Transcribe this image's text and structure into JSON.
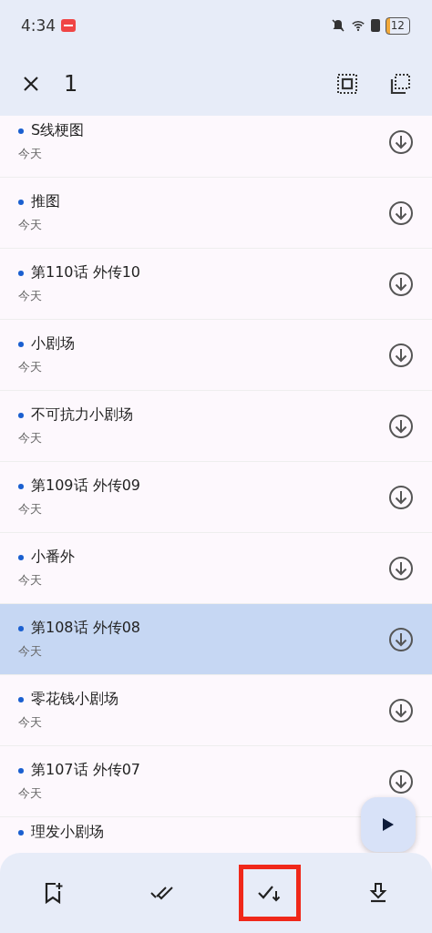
{
  "status_bar": {
    "time": "4:34",
    "battery": "12"
  },
  "top_bar": {
    "selected_count": "1"
  },
  "chapters": [
    {
      "title": "S线梗图",
      "date": "今天",
      "selected": false
    },
    {
      "title": "推图",
      "date": "今天",
      "selected": false
    },
    {
      "title": "第110话 外传10",
      "date": "今天",
      "selected": false
    },
    {
      "title": "小剧场",
      "date": "今天",
      "selected": false
    },
    {
      "title": "不可抗力小剧场",
      "date": "今天",
      "selected": false
    },
    {
      "title": "第109话 外传09",
      "date": "今天",
      "selected": false
    },
    {
      "title": "小番外",
      "date": "今天",
      "selected": false
    },
    {
      "title": "第108话 外传08",
      "date": "今天",
      "selected": true
    },
    {
      "title": "零花钱小剧场",
      "date": "今天",
      "selected": false
    },
    {
      "title": "第107话 外传07",
      "date": "今天",
      "selected": false
    },
    {
      "title": "理发小剧场",
      "selected": false
    }
  ],
  "bottom_actions": [
    {
      "kind": "bookmark",
      "highlighted": false
    },
    {
      "kind": "mark-read",
      "highlighted": false
    },
    {
      "kind": "mark-read-below",
      "highlighted": true
    },
    {
      "kind": "download",
      "highlighted": false
    }
  ]
}
